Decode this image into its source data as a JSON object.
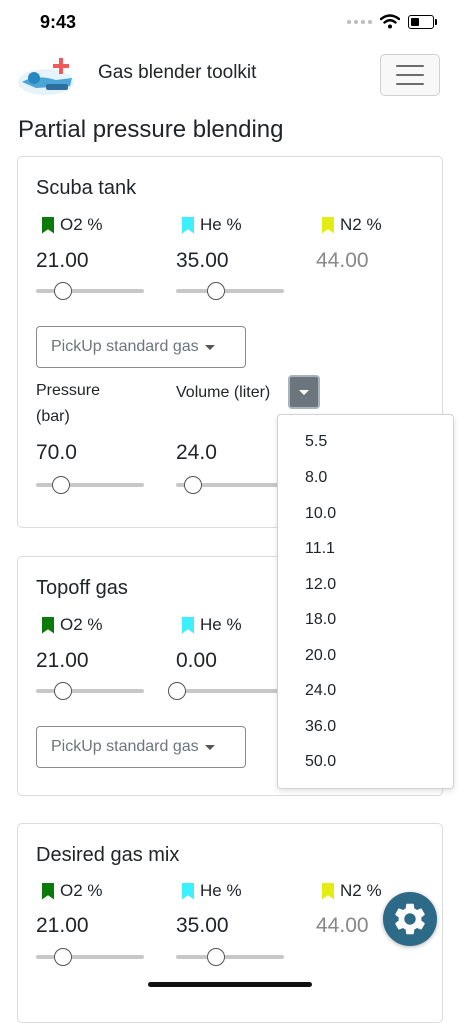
{
  "status_bar": {
    "time": "9:43"
  },
  "header": {
    "app_title": "Gas blender toolkit",
    "page_title": "Partial pressure blending"
  },
  "colors": {
    "o2_flag": "#0a7a0a",
    "he_flag": "#3cf0ff",
    "n2_flag": "#e4ec14",
    "fab": "#2d6a87",
    "muted_value": "#888888"
  },
  "scuba_tank": {
    "title": "Scuba tank",
    "o2": {
      "label": "O2 %",
      "value": "21.00",
      "slider_fraction": 0.24
    },
    "he": {
      "label": "He %",
      "value": "35.00",
      "slider_fraction": 0.36
    },
    "n2": {
      "label": "N2 %",
      "value": "44.00"
    },
    "pickup_label": "PickUp standard gas",
    "pressure": {
      "label_line1": "Pressure",
      "label_line2": "(bar)",
      "value": "70.0",
      "slider_fraction": 0.22
    },
    "volume": {
      "label": "Volume (liter)",
      "value": "24.0",
      "slider_fraction": 0.15
    }
  },
  "topoff_gas": {
    "title": "Topoff gas",
    "o2": {
      "label": "O2 %",
      "value": "21.00",
      "slider_fraction": 0.24
    },
    "he": {
      "label": "He %",
      "value": "0.00",
      "slider_fraction": 0.0
    },
    "pickup_label": "PickUp standard gas"
  },
  "desired_mix": {
    "title": "Desired gas mix",
    "o2": {
      "label": "O2 %",
      "value": "21.00",
      "slider_fraction": 0.24
    },
    "he": {
      "label": "He %",
      "value": "35.00",
      "slider_fraction": 0.36
    },
    "n2": {
      "label": "N2 %",
      "value": "44.00"
    }
  },
  "volume_options": [
    "5.5",
    "8.0",
    "10.0",
    "11.1",
    "12.0",
    "18.0",
    "20.0",
    "24.0",
    "36.0",
    "50.0"
  ],
  "icons": {
    "logo": "scuba-logo-icon",
    "menu": "hamburger-menu-icon",
    "settings": "gear-icon",
    "wifi": "wifi-icon",
    "battery": "battery-icon"
  }
}
